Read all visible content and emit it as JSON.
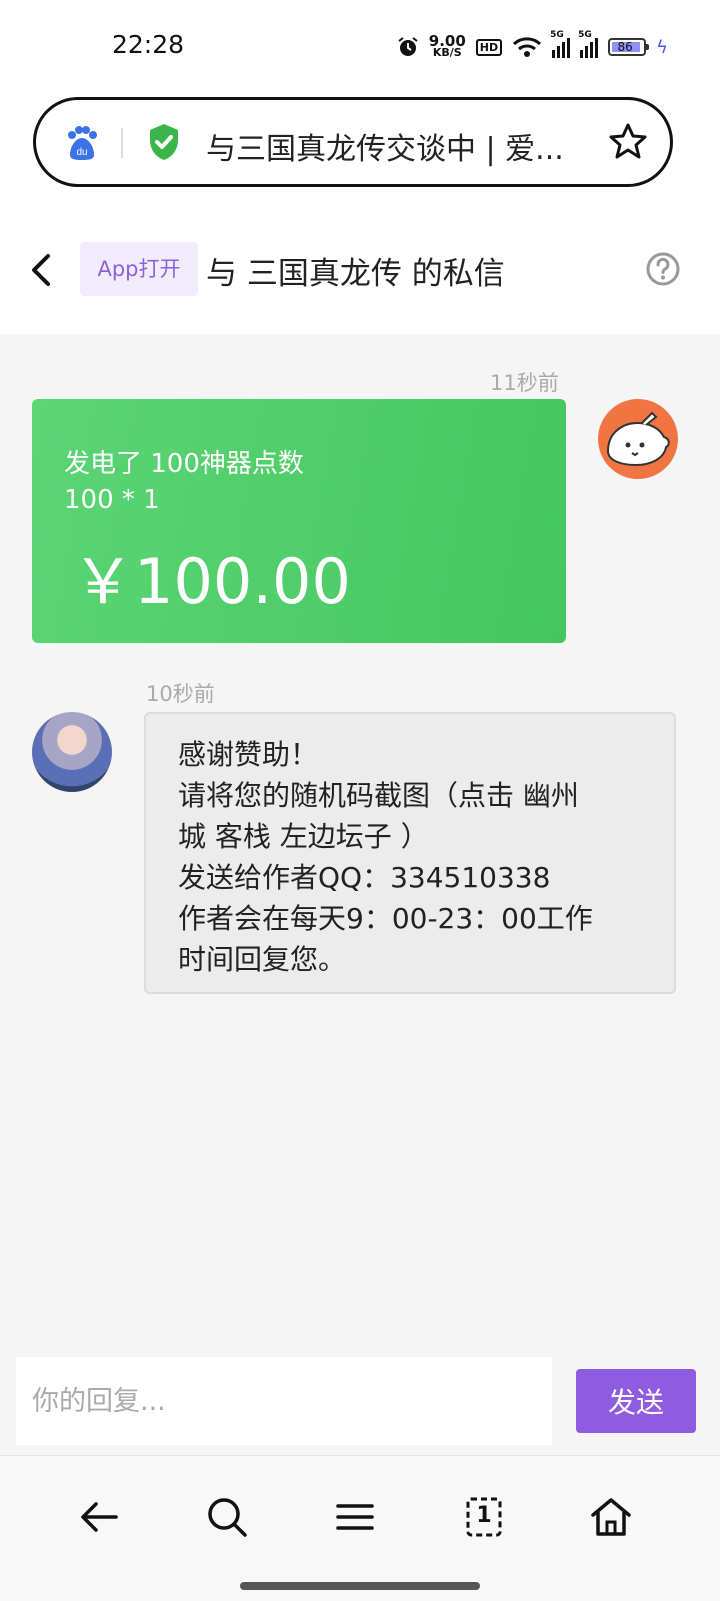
{
  "status_bar": {
    "time": "22:28",
    "net_speed_value": "9.00",
    "net_speed_unit": "KB/S",
    "hd_label": "HD",
    "signal1_label": "5G",
    "signal2_label": "5G",
    "battery": "86",
    "icons": [
      "alarm-icon",
      "hd-icon",
      "wifi-icon",
      "signal-icon",
      "signal-icon",
      "battery-icon",
      "charging-icon"
    ]
  },
  "address_bar": {
    "title": "与三国真龙传交谈中 | 爱...",
    "icons": [
      "baidu-logo",
      "shield-check-icon",
      "star-icon"
    ],
    "shield_color": "#3bb54a"
  },
  "header": {
    "app_open_label": "App打开",
    "title": "与 三国真龙传 的私信",
    "icons": [
      "back-icon",
      "help-icon"
    ]
  },
  "messages": [
    {
      "timestamp": "11秒前",
      "side": "right",
      "type": "donation",
      "line1": "发电了 100神器点数",
      "line2": "100 * 1",
      "amount": "￥100.00",
      "color": "#4cca65"
    },
    {
      "timestamp": "10秒前",
      "side": "left",
      "type": "text",
      "lines": [
        "感谢赞助！",
        "请将您的随机码截图（点击 幽州",
        "城 客栈 左边坛子 ）",
        "发送给作者QQ：334510338",
        "作者会在每天9：00-23：00工作",
        "时间回复您。"
      ]
    }
  ],
  "input": {
    "placeholder": "你的回复...",
    "value": "",
    "send_label": "发送",
    "accent": "#8f5be0"
  },
  "bottom_nav": {
    "icons": [
      "back-arrow-icon",
      "search-icon",
      "menu-icon",
      "tabs-icon",
      "home-icon"
    ],
    "tabs_count": "1"
  }
}
